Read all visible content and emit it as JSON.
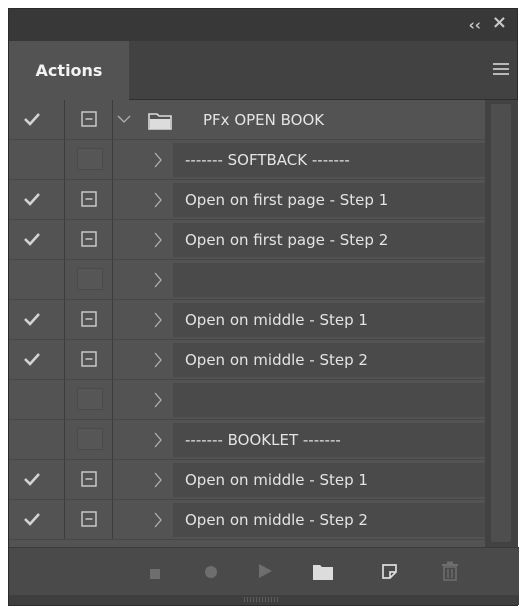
{
  "window": {
    "collapse_label": "‹‹",
    "close_label": "×"
  },
  "panel": {
    "tab_label": "Actions"
  },
  "colors": {
    "panel_bg": "#535353",
    "titlebar_bg": "#383838",
    "action_cell_bg": "#4a4a4a",
    "text": "#e4e4e4",
    "icon": "#c8c8c8",
    "disabled_icon": "#6a6a6a"
  },
  "action_set": {
    "name": "PFx OPEN BOOK",
    "enabled": true,
    "dialog": true,
    "expanded": true
  },
  "actions": [
    {
      "label": "------- SOFTBACK -------",
      "enabled": false,
      "dialog": false
    },
    {
      "label": "Open on first page - Step 1",
      "enabled": true,
      "dialog": true
    },
    {
      "label": "Open on first page - Step 2",
      "enabled": true,
      "dialog": true
    },
    {
      "label": "",
      "enabled": false,
      "dialog": false
    },
    {
      "label": "Open on middle - Step 1",
      "enabled": true,
      "dialog": true
    },
    {
      "label": "Open on middle - Step 2",
      "enabled": true,
      "dialog": true
    },
    {
      "label": "",
      "enabled": false,
      "dialog": false
    },
    {
      "label": "------- BOOKLET -------",
      "enabled": false,
      "dialog": false
    },
    {
      "label": "Open on middle - Step 1",
      "enabled": true,
      "dialog": true
    },
    {
      "label": "Open on middle - Step 2",
      "enabled": true,
      "dialog": true
    }
  ],
  "footer": {
    "buttons": [
      {
        "name": "stop-icon",
        "enabled": false
      },
      {
        "name": "record-icon",
        "enabled": false
      },
      {
        "name": "play-icon",
        "enabled": false
      },
      {
        "name": "new-set-icon",
        "enabled": true
      },
      {
        "name": "new-action-icon",
        "enabled": true
      },
      {
        "name": "trash-icon",
        "enabled": false
      }
    ]
  }
}
